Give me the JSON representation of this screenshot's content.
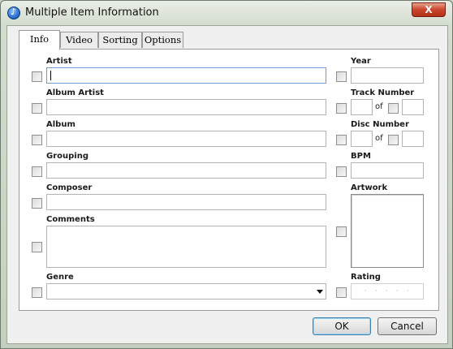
{
  "window": {
    "title": "Multiple Item Information",
    "close_glyph": "X"
  },
  "tabs": [
    {
      "label": "Info",
      "active": true
    },
    {
      "label": "Video",
      "active": false
    },
    {
      "label": "Sorting",
      "active": false
    },
    {
      "label": "Options",
      "active": false
    }
  ],
  "left_fields": {
    "artist": {
      "label": "Artist",
      "value": ""
    },
    "album_artist": {
      "label": "Album Artist",
      "value": ""
    },
    "album": {
      "label": "Album",
      "value": ""
    },
    "grouping": {
      "label": "Grouping",
      "value": ""
    },
    "composer": {
      "label": "Composer",
      "value": ""
    },
    "comments": {
      "label": "Comments",
      "value": ""
    },
    "genre": {
      "label": "Genre",
      "value": ""
    }
  },
  "right_fields": {
    "year": {
      "label": "Year",
      "value": ""
    },
    "track_number": {
      "label": "Track Number",
      "value": "",
      "of_label": "of",
      "total": ""
    },
    "disc_number": {
      "label": "Disc Number",
      "value": "",
      "of_label": "of",
      "total": ""
    },
    "bpm": {
      "label": "BPM",
      "value": ""
    },
    "artwork": {
      "label": "Artwork"
    },
    "rating": {
      "label": "Rating",
      "value": 0,
      "max": 5,
      "dot": "·"
    }
  },
  "buttons": {
    "ok": "OK",
    "cancel": "Cancel"
  },
  "colors": {
    "focus_border": "#6f9cd4",
    "close_button": "#c8442a"
  }
}
